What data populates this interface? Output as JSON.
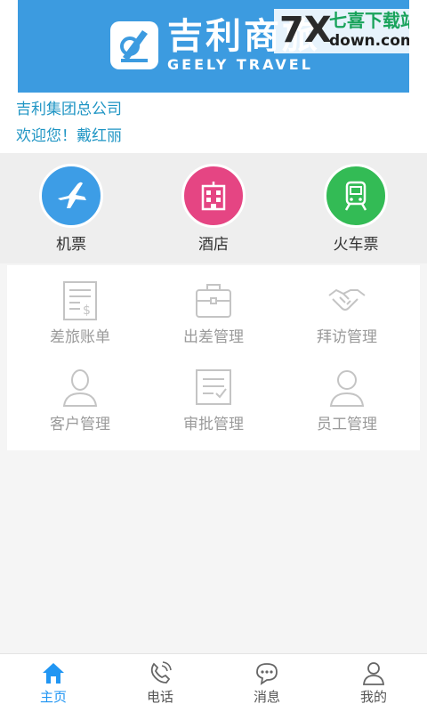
{
  "banner": {
    "logo_cn": "吉利商旅",
    "logo_en": "GEELY TRAVEL",
    "watermark": {
      "mark": "7X",
      "top": "七喜下载站",
      "bottom": "down.com"
    }
  },
  "company": {
    "name": "吉利集团总公司",
    "greeting": "欢迎您！戴红丽"
  },
  "quick_items": [
    {
      "label": "机票",
      "icon": "plane-icon",
      "color": "#3d9de6"
    },
    {
      "label": "酒店",
      "icon": "hotel-icon",
      "color": "#e54583"
    },
    {
      "label": "火车票",
      "icon": "train-icon",
      "color": "#33bb55"
    }
  ],
  "grid_items": [
    {
      "label": "差旅账单",
      "icon": "bill-icon"
    },
    {
      "label": "出差管理",
      "icon": "briefcase-icon"
    },
    {
      "label": "拜访管理",
      "icon": "handshake-icon"
    },
    {
      "label": "客户管理",
      "icon": "customer-icon"
    },
    {
      "label": "审批管理",
      "icon": "approval-icon"
    },
    {
      "label": "员工管理",
      "icon": "employee-icon"
    }
  ],
  "bottom_nav": [
    {
      "label": "主页",
      "icon": "home-icon",
      "active": true
    },
    {
      "label": "电话",
      "icon": "phone-icon",
      "active": false
    },
    {
      "label": "消息",
      "icon": "message-icon",
      "active": false
    },
    {
      "label": "我的",
      "icon": "profile-icon",
      "active": false
    }
  ],
  "colors": {
    "banner": "#3c9be0",
    "info_text": "#1f95c4",
    "nav_active": "#2196f3",
    "grid_icon": "#c4c4c4"
  }
}
